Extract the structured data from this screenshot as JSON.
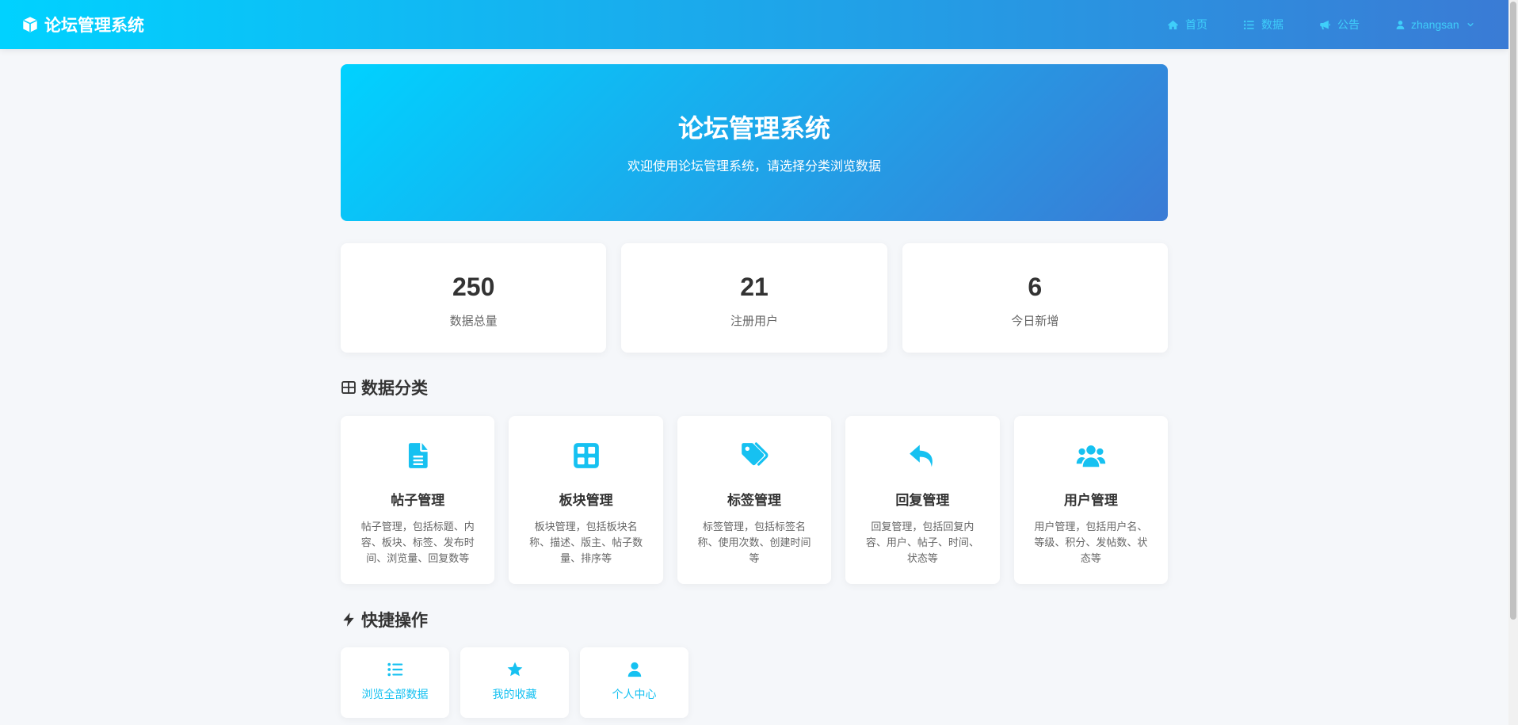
{
  "header": {
    "brand": "论坛管理系统",
    "brand_icon": "cube-icon",
    "nav": [
      {
        "label": "首页",
        "icon": "home-icon"
      },
      {
        "label": "数据",
        "icon": "list-icon"
      },
      {
        "label": "公告",
        "icon": "bullhorn-icon"
      }
    ],
    "user": {
      "name": "zhangsan",
      "icon": "user-icon",
      "caret_icon": "chevron-down-icon"
    }
  },
  "hero": {
    "title": "论坛管理系统",
    "subtitle": "欢迎使用论坛管理系统，请选择分类浏览数据"
  },
  "stats": [
    {
      "value": 250,
      "label": "数据总量"
    },
    {
      "value": 21,
      "label": "注册用户"
    },
    {
      "value": 6,
      "label": "今日新增"
    }
  ],
  "category_section": {
    "title": "数据分类",
    "icon": "table-icon"
  },
  "categories": [
    {
      "title": "帖子管理",
      "icon": "file-icon",
      "desc": "帖子管理，包括标题、内容、板块、标签、发布时间、浏览量、回复数等"
    },
    {
      "title": "板块管理",
      "icon": "grid-icon",
      "desc": "板块管理，包括板块名称、描述、版主、帖子数量、排序等"
    },
    {
      "title": "标签管理",
      "icon": "tags-icon",
      "desc": "标签管理，包括标签名称、使用次数、创建时间等"
    },
    {
      "title": "回复管理",
      "icon": "reply-icon",
      "desc": "回复管理，包括回复内容、用户、帖子、时间、状态等"
    },
    {
      "title": "用户管理",
      "icon": "users-icon",
      "desc": "用户管理，包括用户名、等级、积分、发帖数、状态等"
    }
  ],
  "quick_section": {
    "title": "快捷操作",
    "icon": "bolt-icon"
  },
  "quick_actions": [
    {
      "label": "浏览全部数据",
      "icon": "list-icon"
    },
    {
      "label": "我的收藏",
      "icon": "star-icon"
    },
    {
      "label": "个人中心",
      "icon": "user-icon"
    }
  ],
  "colors": {
    "gradient_start": "#00d2ff",
    "gradient_end": "#3a7bd5",
    "accent": "#16c1f1",
    "nav_text": "#3fcffa",
    "page_background": "#f5f7fa",
    "text_primary": "#333333",
    "text_secondary": "#666666"
  }
}
